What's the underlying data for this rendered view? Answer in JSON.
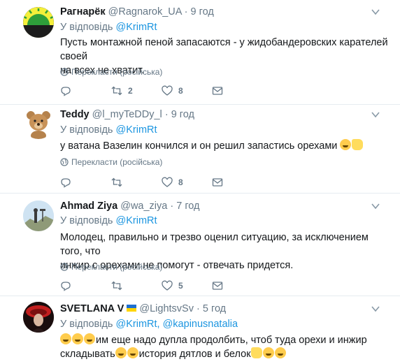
{
  "colors": {
    "accent": "#1b95e0",
    "secondary_text": "#657786",
    "divider": "#e6ecf0"
  },
  "tweets": [
    {
      "name": "Рагнарёк",
      "handle": "@Ragnarok_UA",
      "dot": "·",
      "time": "9 год",
      "reply_prefix": "У відповідь",
      "mentions": "@KrimRt",
      "body_lines": [
        "Пусть монтажной пеной запасаются - у жидобандеровских карателей своей",
        "на всех не хватит."
      ],
      "translate": "Перекласти (російська)",
      "reply_count": "",
      "retweet_count": "2",
      "like_count": "8"
    },
    {
      "name": "Teddy",
      "handle": "@l_myTeDDy_l",
      "dot": "·",
      "time": "9 год",
      "reply_prefix": "У відповідь",
      "mentions": "@KrimRt",
      "body_lines": [
        "у  ватана Вазелин кончился и он решил запастись орехами"
      ],
      "translate": "Перекласти (російська)",
      "reply_count": "",
      "retweet_count": "",
      "like_count": "8"
    },
    {
      "name": "Ahmad Ziya",
      "handle": "@wa_ziya",
      "dot": "·",
      "time": "7 год",
      "reply_prefix": "У відповідь",
      "mentions": "@KrimRt",
      "body_lines": [
        "Молодец, правильно и трезво оценил ситуацию, за исключением того, что",
        "инжир с орехами не помогут - отвечать придется."
      ],
      "translate": "Перекласти (російська)",
      "reply_count": "",
      "retweet_count": "",
      "like_count": "5"
    },
    {
      "name": "SVETLANA V",
      "handle": "@LightsvSv",
      "dot": "·",
      "time": "5 год",
      "reply_prefix": "У відповідь",
      "mentions": "@KrimRt, @kapinusnatalia",
      "body_lines": [
        "им еще надо дупла продолбить, чтоб туда орехи и инжир",
        "складывать",
        "история дятлов и белок"
      ]
    }
  ],
  "icons": [
    "chevron-down-icon",
    "globe-icon",
    "reply-icon",
    "retweet-icon",
    "like-icon",
    "message-icon",
    "laughing-emoji-icon",
    "thumbs-up-emoji-icon",
    "ukraine-flag-icon"
  ]
}
